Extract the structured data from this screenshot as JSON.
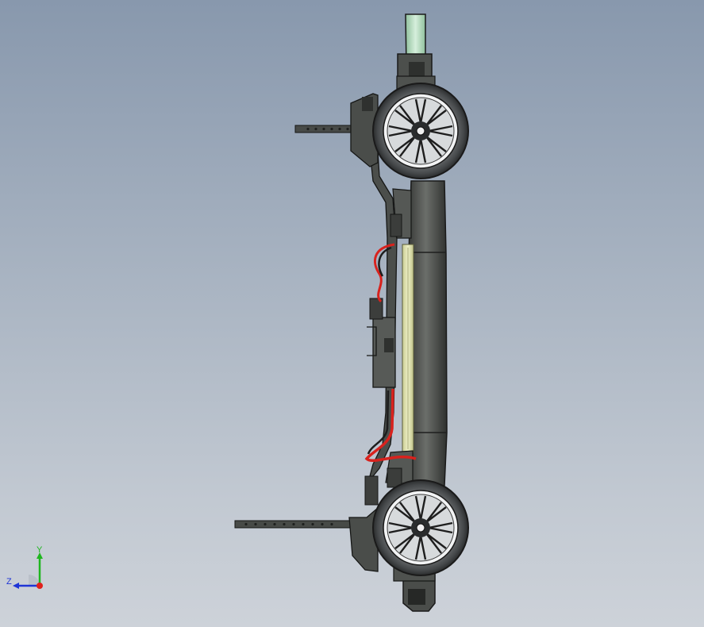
{
  "viewport": {
    "background_top": "#8898ad",
    "background_bottom": "#cdd2d9"
  },
  "model": {
    "colors": {
      "chassis": "#4f524f",
      "chassis_dark": "#2e302e",
      "chassis_light": "#7a7d79",
      "battery": "#e3e6b5",
      "bumper_cap": "#bfe0c8",
      "wire_red": "#d8221d",
      "wire_black": "#1d1d1d",
      "tire": "#55585a",
      "rim": "#e6e8ea"
    }
  },
  "triad": {
    "y_label": "Y",
    "z_label": "Z",
    "colors": {
      "y_axis": "#1fb61f",
      "z_axis": "#1f35d6",
      "x_axis": "#e0201b"
    }
  }
}
